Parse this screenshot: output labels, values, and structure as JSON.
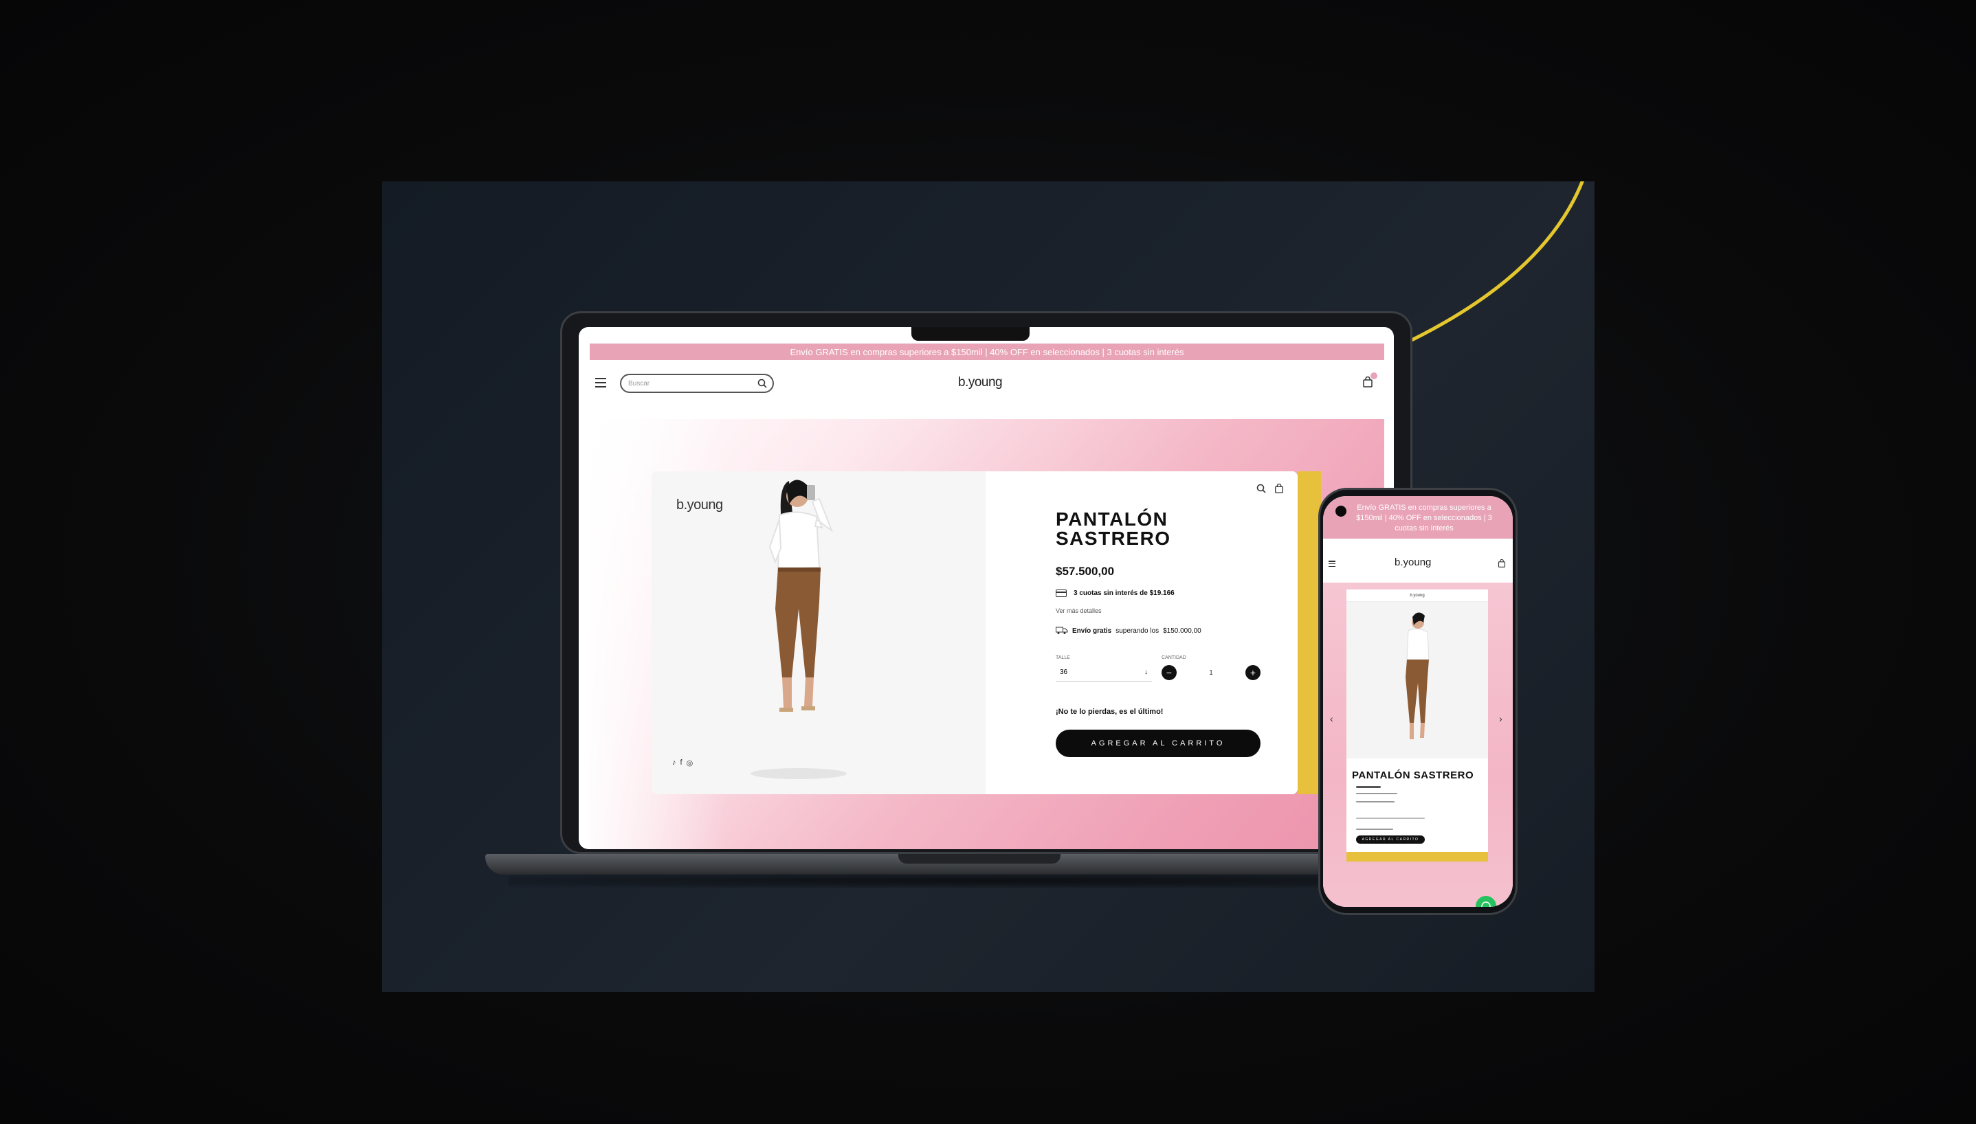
{
  "colors": {
    "accent_pink": "#e8a3b7",
    "accent_yellow": "#e7c13c",
    "dark": "#0c0c0c"
  },
  "desktop": {
    "promo_text": "Envío GRATIS en compras superiores a $150mil | 40% OFF en seleccionados | 3 cuotas sin interés",
    "search_placeholder": "Buscar",
    "brand": "b.young",
    "card_brand": "b.young",
    "product": {
      "title": "PANTALÓN SASTRERO",
      "price": "$57.500,00",
      "cuotas": "3 cuotas sin interés de $19.166",
      "details_link": "Ver más detalles",
      "envio_bold": "Envío gratis",
      "envio_text": "superando los",
      "envio_amount": "$150.000,00",
      "talle_label": "TALLE",
      "talle_value": "36",
      "cantidad_label": "CANTIDAD",
      "cantidad_value": "1",
      "last_item": "¡No te lo pierdas, es el último!",
      "add_to_cart": "AGREGAR AL CARRITO"
    },
    "icons": [
      "menu-icon",
      "search-icon",
      "bag-icon",
      "tiktok-icon",
      "facebook-icon",
      "instagram-icon",
      "card-icon",
      "truck-icon"
    ]
  },
  "mobile": {
    "promo_text": "Envío GRATIS en compras superiores a $150mil | 40% OFF en seleccionados | 3 cuotas sin interés",
    "brand": "b.young",
    "card_brand": "b.young",
    "product_title": "PANTALÓN SASTRERO",
    "add_to_cart": "AGREGAR AL CARRITO"
  }
}
